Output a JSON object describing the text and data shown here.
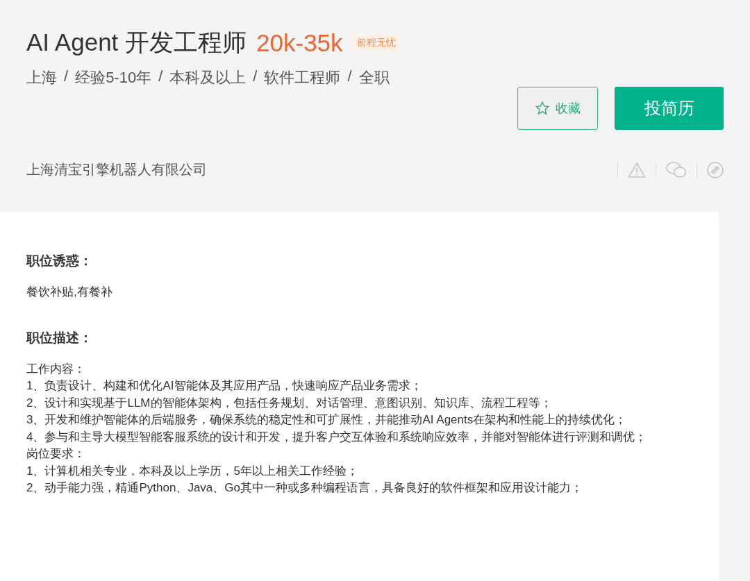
{
  "header": {
    "title": "AI Agent 开发工程师",
    "salary": "20k-35k",
    "tag": "前程无忧",
    "meta": [
      "上海",
      "经验5-10年",
      "本科及以上",
      "软件工程师",
      "全职"
    ],
    "meta_separator": "/",
    "favorite_button": {
      "label": "收藏"
    },
    "apply_button": {
      "label": "投简历"
    },
    "company": "上海清宝引擎机器人有限公司"
  },
  "sections": [
    {
      "heading": "职位诱惑：",
      "lines": [
        "餐饮补贴,有餐补"
      ]
    },
    {
      "heading": "职位描述：",
      "lines": [
        "工作内容：",
        "1、负责设计、构建和优化AI智能体及其应用产品，快速响应产品业务需求；",
        "2、设计和实现基于LLM的智能体架构，包括任务规划、对话管理、意图识别、知识库、流程工程等；",
        "3、开发和维护智能体的后端服务，确保系统的稳定性和可扩展性，并能推动AI Agents在架构和性能上的持续优化；",
        "4、参与和主导大模型智能客服系统的设计和开发，提升客户交互体验和系统响应效率，并能对智能体进行评测和调优；",
        "岗位要求：",
        "1、计算机相关专业，本科及以上学历，5年以上相关工作经验；",
        "2、动手能力强，精通Python、Java、Go其中一种或多种编程语言，具备良好的软件框架和应用设计能力；"
      ]
    }
  ]
}
